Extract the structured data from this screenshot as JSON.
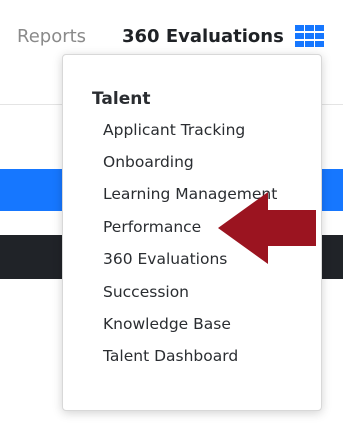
{
  "header": {
    "reports_label": "Reports",
    "active_label": "360 Evaluations",
    "grid_icon": "app-grid-icon"
  },
  "colors": {
    "accent_blue": "#1677ff",
    "dark_band": "#202328",
    "arrow_red": "#9b1420"
  },
  "menu": {
    "heading": "Talent",
    "items": [
      "Applicant Tracking",
      "Onboarding",
      "Learning Management",
      "Performance",
      "360 Evaluations",
      "Succession",
      "Knowledge Base",
      "Talent Dashboard"
    ]
  },
  "annotation": {
    "arrow_icon": "red-left-arrow-icon",
    "points_to": "Performance"
  }
}
